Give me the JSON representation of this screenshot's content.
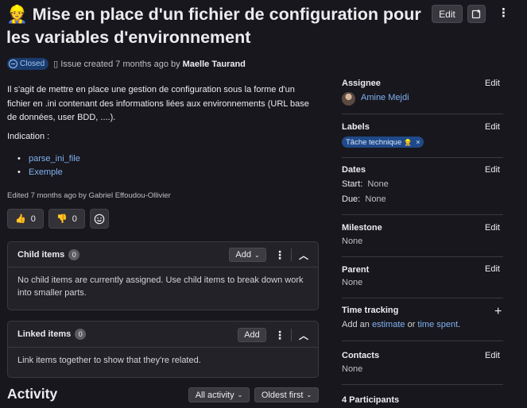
{
  "issue": {
    "title_emoji": "👷",
    "title": "Mise en place d'un fichier de configuration pour les variables d'environnement",
    "status": "Closed",
    "created_text": "Issue created 7 months ago by",
    "author": "Maelle Taurand",
    "description": "Il s'agit de mettre en place une gestion de configuration sous la forme d'un fichier en .ini contenant des informations liées aux environnements (URL base de données, user BDD, ....).",
    "indication_label": "Indication :",
    "indication_links": [
      "parse_ini_file",
      "Exemple"
    ],
    "edited_text": "Edited 7 months ago by Gabriel Effoudou-Ollivier"
  },
  "header": {
    "edit_label": "Edit"
  },
  "reactions": {
    "thumbs_up": "0",
    "thumbs_down": "0"
  },
  "child_items": {
    "title": "Child items",
    "count": "0",
    "add_label": "Add",
    "empty_text": "No child items are currently assigned. Use child items to break down work into smaller parts."
  },
  "linked_items": {
    "title": "Linked items",
    "count": "0",
    "add_label": "Add",
    "empty_text": "Link items together to show that they're related."
  },
  "activity": {
    "title": "Activity",
    "filter": "All activity",
    "sort": "Oldest first"
  },
  "sidebar": {
    "edit_label": "Edit",
    "assignee": {
      "label": "Assignee",
      "name": "Amine Mejdi"
    },
    "labels": {
      "label": "Labels",
      "chip": "Tâche technique",
      "chip_emoji": "👷"
    },
    "dates": {
      "label": "Dates",
      "start_label": "Start:",
      "start": "None",
      "due_label": "Due:",
      "due": "None"
    },
    "milestone": {
      "label": "Milestone",
      "value": "None"
    },
    "parent": {
      "label": "Parent",
      "value": "None"
    },
    "time_tracking": {
      "label": "Time tracking",
      "prefix": "Add an",
      "estimate": "estimate",
      "or": "or",
      "time_spent": "time spent",
      "suffix": "."
    },
    "contacts": {
      "label": "Contacts",
      "value": "None"
    },
    "participants": "4 Participants"
  },
  "colors": {
    "background": "#18171d",
    "link": "#7fb2f0",
    "closed_badge": "#1a3b6e",
    "label_chip": "#1f4a8a"
  }
}
